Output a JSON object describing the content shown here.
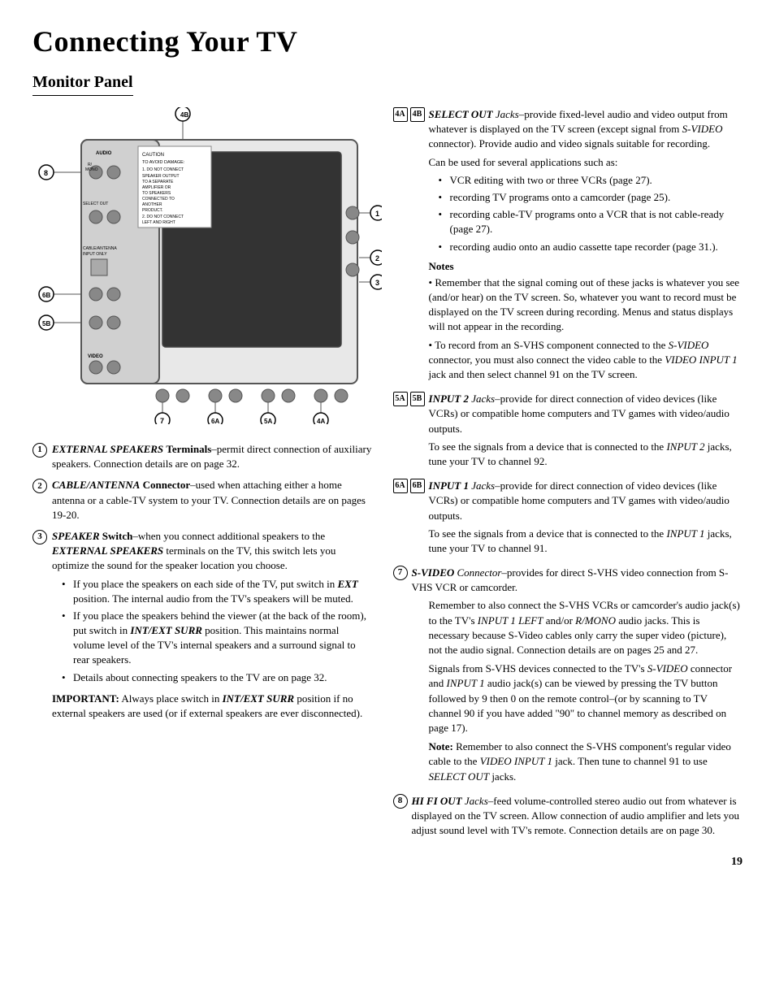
{
  "title": "Connecting Your TV",
  "section": "Monitor Panel",
  "left_items": [
    {
      "number": "1",
      "type": "circle",
      "label": "EXTERNAL SPEAKERS",
      "label_suffix": " Terminals",
      "text": "–permit direct connection of auxiliary speakers. Connection details are on page 32."
    },
    {
      "number": "2",
      "type": "circle",
      "label": "CABLE/ANTENNA",
      "label_suffix": " Connector",
      "text": "–used when attaching either a home antenna or a cable-TV system to your TV. Connection details are on pages 19-20."
    },
    {
      "number": "3",
      "type": "circle",
      "label": "SPEAKER",
      "label_suffix": " Switch",
      "text": "–when you connect additional speakers to the ",
      "text2": "EXTERNAL SPEAKERS",
      "text3": " terminals on the TV, this switch lets you optimize the sound for the speaker location you choose.",
      "bullets": [
        "If you place the speakers on each side of the TV, put switch in EXT position.  The internal audio from the TV's speakers will be muted.",
        "If you place the speakers behind the viewer (at the back of the room), put switch in INT/EXT SURR position. This maintains normal volume level of the TV's internal speakers and a surround signal to rear speakers.",
        "Details about connecting speakers to the TV are on page 32."
      ],
      "important": "IMPORTANT:  Always place switch in INT/EXT SURR position if no external speakers are used (or if external speakers are ever disconnected)."
    }
  ],
  "right_items": [
    {
      "numbers": [
        "4A",
        "4B"
      ],
      "types": [
        "sq",
        "sq"
      ],
      "label": "SELECT OUT",
      "label_suffix": " Jacks",
      "text": "–provide fixed-level audio and video output from whatever is displayed on the TV screen (except signal from S-VIDEO connector). Provide audio and video signals suitable for recording.",
      "can_be_used": "Can be used for several applications such as:",
      "bullets": [
        "VCR editing with two or three VCRs (page 27).",
        "recording TV programs onto a camcorder (page 25).",
        "recording cable-TV programs onto a VCR that is not cable-ready (page 27).",
        "recording audio onto an audio cassette tape recorder (page 31.)."
      ],
      "notes_label": "Notes",
      "notes": [
        "Remember that the signal coming out of these jacks is whatever you see (and/or hear) on the TV screen. So, whatever you want to record must be displayed on the TV screen during recording. Menus and status displays will not appear in the recording.",
        "To record from an S-VHS component connected to the S-VIDEO connector, you must also connect the video cable to the VIDEO INPUT 1 jack and then select channel 91 on the TV screen."
      ]
    },
    {
      "numbers": [
        "5A",
        "5B"
      ],
      "types": [
        "sq",
        "sq"
      ],
      "label": "INPUT 2",
      "label_suffix": " Jacks",
      "text": "–provide for direct connection of video devices (like VCRs) or compatible home computers and TV games with video/audio outputs.",
      "sub_text": "To see the signals from a device that is connected to the INPUT 2 jacks, tune your TV to channel 92."
    },
    {
      "numbers": [
        "6A",
        "6B"
      ],
      "types": [
        "sq",
        "sq"
      ],
      "label": "INPUT 1",
      "label_suffix": " Jacks",
      "text": "–provide for direct connection of video devices (like VCRs) or compatible home computers and TV games with video/audio outputs.",
      "sub_text": "To see the signals from a device that is connected to the INPUT 1 jacks, tune your TV to channel 91."
    },
    {
      "numbers": [
        "7"
      ],
      "types": [
        "circle"
      ],
      "label": "S-VIDEO",
      "label_suffix": " Connector",
      "text": "–provides for direct S-VHS video connection from S-VHS VCR or camcorder.",
      "sub_texts": [
        "Remember to also connect the S-VHS VCRs or camcorder's audio jack(s) to the TV's INPUT 1 LEFT and/or R/MONO audio jacks.  This is necessary because S-Video cables only carry the super video (picture), not the audio signal. Connection details are on pages 25 and 27.",
        "Signals from S-VHS devices connected to the TV's S-VIDEO connector and INPUT 1 audio jack(s) can be viewed by pressing the TV button followed by 9 then 0 on the remote control–(or by scanning to TV channel 90 if you have added \"90\" to channel memory as described on page 17).",
        "Note: Remember to also connect the S-VHS component's regular video cable to the VIDEO INPUT 1 jack. Then tune to channel 91 to use SELECT OUT jacks."
      ]
    },
    {
      "numbers": [
        "8"
      ],
      "types": [
        "circle"
      ],
      "label": "HI FI OUT",
      "label_suffix": " Jacks",
      "text": "–feed volume-controlled stereo audio out from whatever is displayed on the TV screen. Allow connection of audio amplifier and lets you adjust sound level with TV's remote. Connection details are on page 30."
    }
  ],
  "page_number": "19",
  "diagram": {
    "labels": [
      "4B",
      "8",
      "6B",
      "5B",
      "1",
      "2",
      "3",
      "7",
      "6A",
      "5A",
      "4A"
    ]
  }
}
